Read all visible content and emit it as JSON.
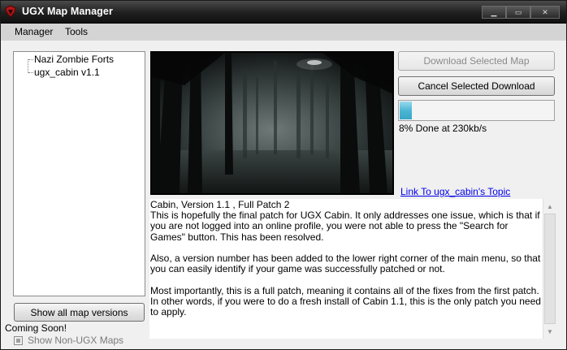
{
  "window": {
    "title": "UGX Map Manager"
  },
  "menu": {
    "manager": "Manager",
    "tools": "Tools"
  },
  "caption": {
    "minimize": "▁",
    "maximize": "▭",
    "close": "✕"
  },
  "map_list": {
    "items": [
      "Nazi Zombie Forts",
      "ugx_cabin v1.1"
    ]
  },
  "buttons": {
    "download": "Download Selected Map",
    "cancel": "Cancel Selected Download",
    "show_all": "Show all map versions"
  },
  "progress": {
    "percent": 8,
    "text": "8% Done at 230kb/s",
    "fill_color": "#4cb6d4"
  },
  "topic_link": "Link To ugx_cabin's Topic",
  "description": {
    "text": "Cabin, Version 1.1 , Full Patch 2\nThis is hopefully the final patch for UGX Cabin. It only addresses one issue, which is that if you are not logged into an online profile, you were not able to press the \"Search for Games\" button. This has been resolved.\n\nAlso, a version number has been added to the lower right corner of the main menu, so that you can easily identify if your game was successfully patched or not.\n\nMost importantly, this is a full patch, meaning it contains all of the fixes from the first patch. In other words, if you were to do a fresh install of Cabin 1.1, this is the only patch you need to apply."
  },
  "footer": {
    "coming_soon": "Coming Soon!",
    "show_non_ugx": "Show Non-UGX Maps",
    "show_non_ugx_checked": false
  },
  "icons": {
    "app": "ugx-logo-icon",
    "scroll_up": "scroll-up-arrow-icon",
    "scroll_down": "scroll-down-arrow-icon"
  }
}
